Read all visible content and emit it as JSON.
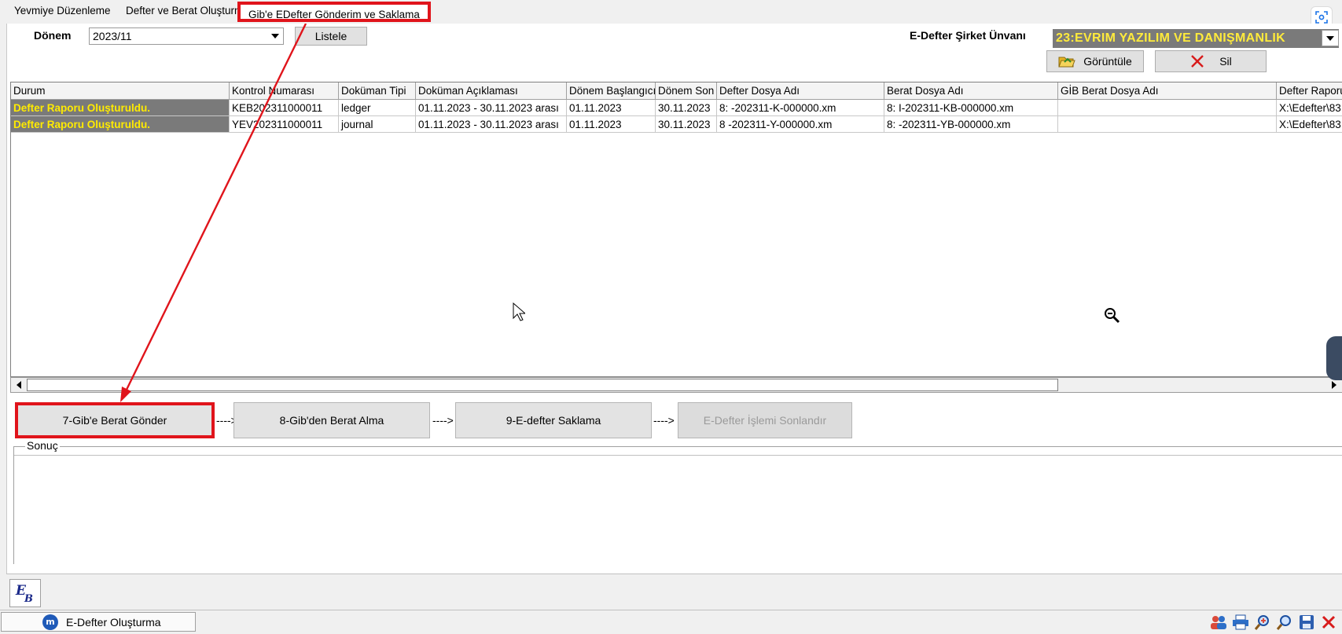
{
  "tabs": {
    "tab1": "Yevmiye Düzenleme",
    "tab2": "Defter ve Berat Oluşturma",
    "tab3": "Gib'e EDefter Gönderim ve Saklama"
  },
  "filter": {
    "period_label": "Dönem",
    "period_value": "2023/11",
    "list_button": "Listele",
    "company_label": "E-Defter Şirket Ünvanı",
    "company_value": "23:EVRIM YAZILIM VE DANIŞMANLIK",
    "view_button": "Görüntüle",
    "delete_button": "Sil"
  },
  "grid": {
    "headers": [
      "Durum",
      "Kontrol Numarası",
      "Doküman Tipi",
      "Doküman Açıklaması",
      "Dönem Başlangıcı",
      "Dönem Son",
      "Defter Dosya Adı",
      "Berat Dosya Adı",
      "GİB Berat Dosya Adı",
      "Defter Raporu"
    ],
    "rows": [
      {
        "status": "Defter Raporu Oluşturuldu.",
        "control_no": "KEB202311000011",
        "doc_type": "ledger",
        "doc_desc": "01.11.2023 - 30.11.2023 arası",
        "start": "01.11.2023",
        "end": "30.11.2023",
        "ledger_file": "8:              -202311-K-000000.xm",
        "berat_file": "8:              I-202311-KB-000000.xm",
        "gib_berat_file": "",
        "report": "X:\\Edefter\\83"
      },
      {
        "status": "Defter Raporu Oluşturuldu.",
        "control_no": "YEV202311000011",
        "doc_type": "journal",
        "doc_desc": "01.11.2023 - 30.11.2023 arası",
        "start": "01.11.2023",
        "end": "30.11.2023",
        "ledger_file": "8               -202311-Y-000000.xm",
        "berat_file": "8:               -202311-YB-000000.xm",
        "gib_berat_file": "",
        "report": "X:\\Edefter\\83"
      }
    ]
  },
  "steps": {
    "step7": "7-Gib'e Berat Gönder",
    "step8": "8-Gib'den Berat Alma",
    "step9": "9-E-defter Saklama",
    "finish": "E-Defter İşlemi Sonlandır",
    "connector": "---->"
  },
  "result": {
    "label": "Sonuç"
  },
  "taskbar": {
    "window_label": "E-Defter Oluşturma"
  },
  "icons": [
    "screenshot-icon",
    "dropdown-arrow-icon",
    "folder-open-icon",
    "delete-x-icon",
    "zoom-out-icon",
    "mouse-cursor-icon",
    "eb-logo-icon",
    "users-icon",
    "print-icon",
    "zoom-in-icon",
    "search-icon",
    "save-icon",
    "close-icon"
  ],
  "colors": {
    "highlight_red": "#e0141b",
    "status_bg": "#7a7a7a",
    "status_text": "#ffeb00"
  }
}
